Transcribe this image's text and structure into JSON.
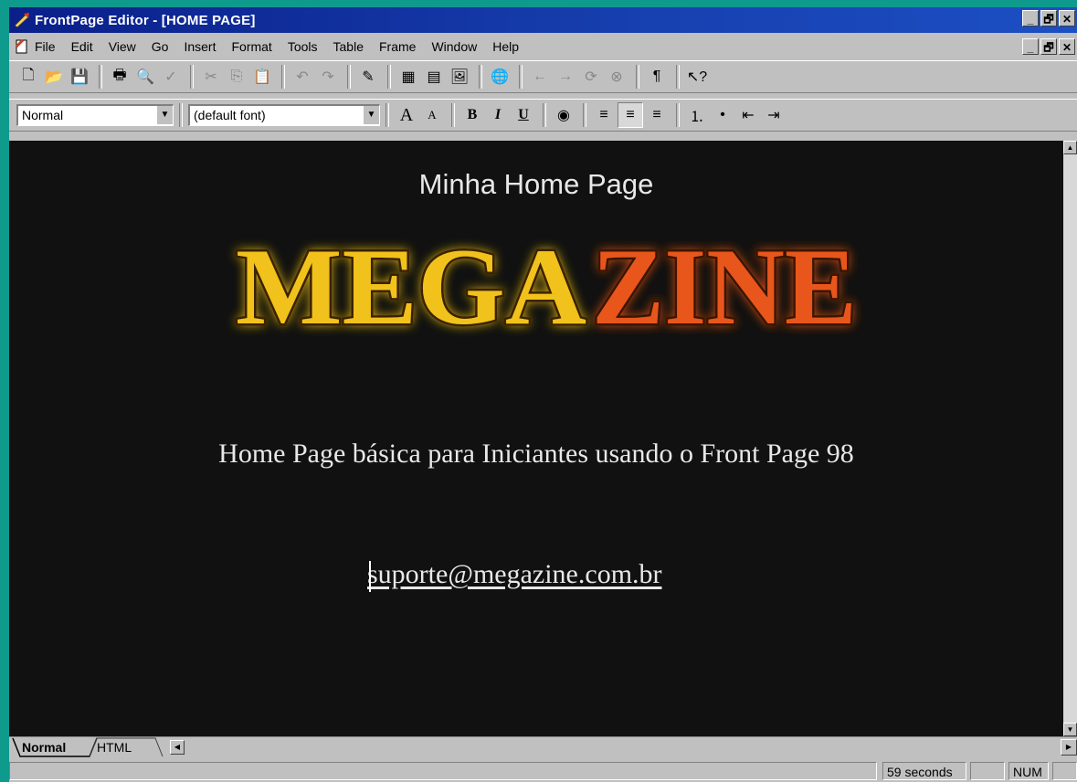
{
  "window": {
    "title": "FrontPage Editor - [HOME PAGE]",
    "caption_buttons": [
      "_",
      "🗗",
      "✕"
    ],
    "app_icon": "frontpage-logo-icon"
  },
  "menubar": {
    "doc_icon": "document-icon",
    "items": [
      "File",
      "Edit",
      "View",
      "Go",
      "Insert",
      "Format",
      "Tools",
      "Table",
      "Frame",
      "Window",
      "Help"
    ],
    "mdi_buttons": [
      "_",
      "🗗",
      "✕"
    ]
  },
  "standard_toolbar": {
    "icons": [
      "new-page-icon",
      "open-icon",
      "save-icon",
      "print-icon",
      "print-preview-icon",
      "spelling-icon",
      "cut-icon",
      "copy-icon",
      "paste-icon",
      "undo-icon",
      "redo-icon",
      "webbot-icon",
      "insert-table-icon",
      "insert-form-icon",
      "insert-image-icon",
      "hyperlink-icon",
      "back-icon",
      "forward-icon",
      "refresh-icon",
      "stop-icon",
      "show-paragraph-icon",
      "help-pointer-icon"
    ],
    "glyphs": [
      "🗋",
      "📂",
      "💾",
      "🖶",
      "🔍",
      "✓",
      "✂",
      "⎘",
      "📋",
      "↶",
      "↷",
      "✎",
      "▦",
      "▤",
      "🖼",
      "🌐",
      "←",
      "→",
      "⟳",
      "⊗",
      "¶",
      "↖?"
    ]
  },
  "format_toolbar": {
    "style_value": "Normal",
    "font_value": "(default font)",
    "buttons": [
      "A",
      "A",
      "B",
      "I",
      "U",
      "◉",
      "≡",
      "≡",
      "≡",
      "⒈",
      "•",
      "⇤",
      "⇥"
    ],
    "icons": [
      "increase-font-icon",
      "decrease-font-icon",
      "bold-icon",
      "italic-icon",
      "underline-icon",
      "text-color-icon",
      "align-left-icon",
      "align-center-icon",
      "align-right-icon",
      "numbered-list-icon",
      "bulleted-list-icon",
      "decrease-indent-icon",
      "increase-indent-icon"
    ]
  },
  "page": {
    "heading": "Minha Home Page",
    "logo_text_left": "MEGA",
    "logo_text_right": "ZINE",
    "logo_colors": {
      "left": "#f2c21a",
      "right": "#e8561c"
    },
    "subtitle": "Home Page básica para Iniciantes usando o Front Page 98",
    "email": "suporte@megazine.com.br",
    "background": "#101110"
  },
  "view_tabs": {
    "normal": "Normal",
    "html": "HTML"
  },
  "statusbar": {
    "time": "59 seconds",
    "num": "NUM"
  }
}
